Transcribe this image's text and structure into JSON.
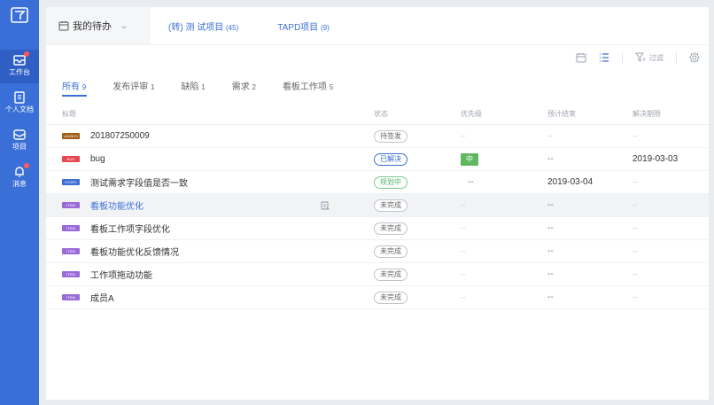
{
  "sidebar": {
    "items": [
      {
        "label": "工作台",
        "icon": "inbox-icon",
        "active": true
      },
      {
        "label": "个人文档",
        "icon": "document-icon"
      },
      {
        "label": "项目",
        "icon": "project-icon"
      },
      {
        "label": "消息",
        "icon": "bell-icon"
      }
    ]
  },
  "topbar": {
    "mytodo_label": "我的待办",
    "projects": [
      {
        "name": "(转) 测 试项目",
        "count": "(45)"
      },
      {
        "name": "TAPD项目",
        "count": "(9)"
      }
    ]
  },
  "toolbar": {
    "filter_label": "过滤"
  },
  "tabs": [
    {
      "label": "所有",
      "count": "9"
    },
    {
      "label": "发布评审",
      "count": "1"
    },
    {
      "label": "缺陷",
      "count": "1"
    },
    {
      "label": "需求",
      "count": "2"
    },
    {
      "label": "看板工作项",
      "count": "5"
    }
  ],
  "table": {
    "headers": {
      "title": "标题",
      "status": "状态",
      "priority": "优先级",
      "planned_end": "预计结束",
      "due": "解决期限"
    },
    "rows": [
      {
        "type": "LAUNCH",
        "title": "201807250009",
        "status": "待签发",
        "priority": "--",
        "planned_end": "--",
        "due": "--"
      },
      {
        "type": "BUG",
        "title": "bug",
        "status": "已解决",
        "priority": "中",
        "planned_end": "--",
        "due": "2019-03-03"
      },
      {
        "type": "STORY",
        "title": "测试需求字段值是否一致",
        "status": "规划中",
        "priority": "--",
        "planned_end": "2019-03-04",
        "due": "--"
      },
      {
        "type": "ITEM",
        "title": "看板功能优化",
        "status": "未完成",
        "priority": "--",
        "planned_end": "--",
        "due": "--"
      },
      {
        "type": "ITEM",
        "title": "看板工作项字段优化",
        "status": "未完成",
        "priority": "--",
        "planned_end": "--",
        "due": "--"
      },
      {
        "type": "ITEM",
        "title": "看板功能优化反馈情况",
        "status": "未完成",
        "priority": "--",
        "planned_end": "--",
        "due": "--"
      },
      {
        "type": "ITEM",
        "title": "工作项拖动功能",
        "status": "未完成",
        "priority": "--",
        "planned_end": "--",
        "due": "--"
      },
      {
        "type": "ITEM",
        "title": "成员A",
        "status": "未完成",
        "priority": "--",
        "planned_end": "--",
        "due": "--"
      }
    ]
  },
  "colors": {
    "accent": "#3a6fd8",
    "sidebar": "#3a6fd8",
    "priority_mid": "#5fb85f"
  }
}
